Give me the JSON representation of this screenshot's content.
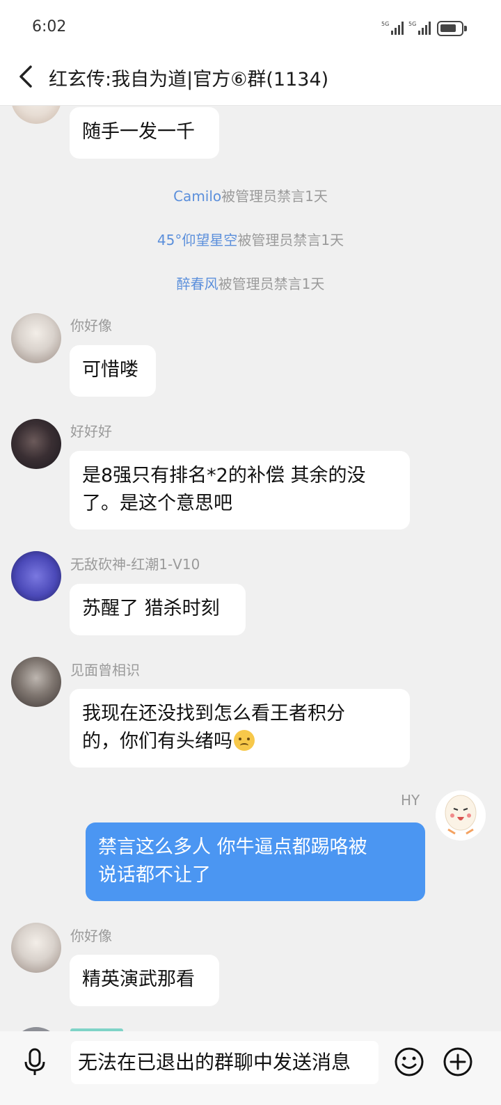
{
  "status_bar": {
    "time": "6:02",
    "signal_1_label": "5G",
    "signal_2_label": "5G"
  },
  "header": {
    "title": "红玄传:我自为道|官方⑥群(1134)"
  },
  "messages": {
    "m0_text": "随手一发一千",
    "sys1_name": "Camilo",
    "sys1_text": "被管理员禁言1天",
    "sys2_name": "45°仰望星空",
    "sys2_text": "被管理员禁言1天",
    "sys3_name": "醉春风",
    "sys3_text": "被管理员禁言1天",
    "m1_sender": "你好像",
    "m1_text": "可惜喽",
    "m2_sender": "好好好",
    "m2_line1": "是8强只有排名*2的补偿 其余的没",
    "m2_line2": "了。是这个意思吧",
    "m3_sender": "无敌砍神-红潮1-V10",
    "m3_text": "苏醒了 猎杀时刻",
    "m4_sender": "见面曾相识",
    "m4_line1": "我现在还没找到怎么看王者积分",
    "m4_line2": "的，你们有头绪吗",
    "m4_emoji": "sweat-smile-emoji",
    "m5_sender": "HY",
    "m5_line1": "禁言这么多人 你牛逼点都踢咯被",
    "m5_line2": "说话都不让了",
    "m6_sender": "你好像",
    "m6_text": "精英演武那看"
  },
  "input_bar": {
    "placeholder": "无法在已退出的群聊中发送消息",
    "voice_icon": "microphone-icon",
    "emoji_icon": "smiley-icon",
    "more_icon": "plus-icon"
  },
  "colors": {
    "background": "#f0f0f0",
    "bubble_other": "#ffffff",
    "bubble_mine": "#4b96f2",
    "system_name": "#5b8fdb",
    "meta_text": "#9a9a9a"
  }
}
